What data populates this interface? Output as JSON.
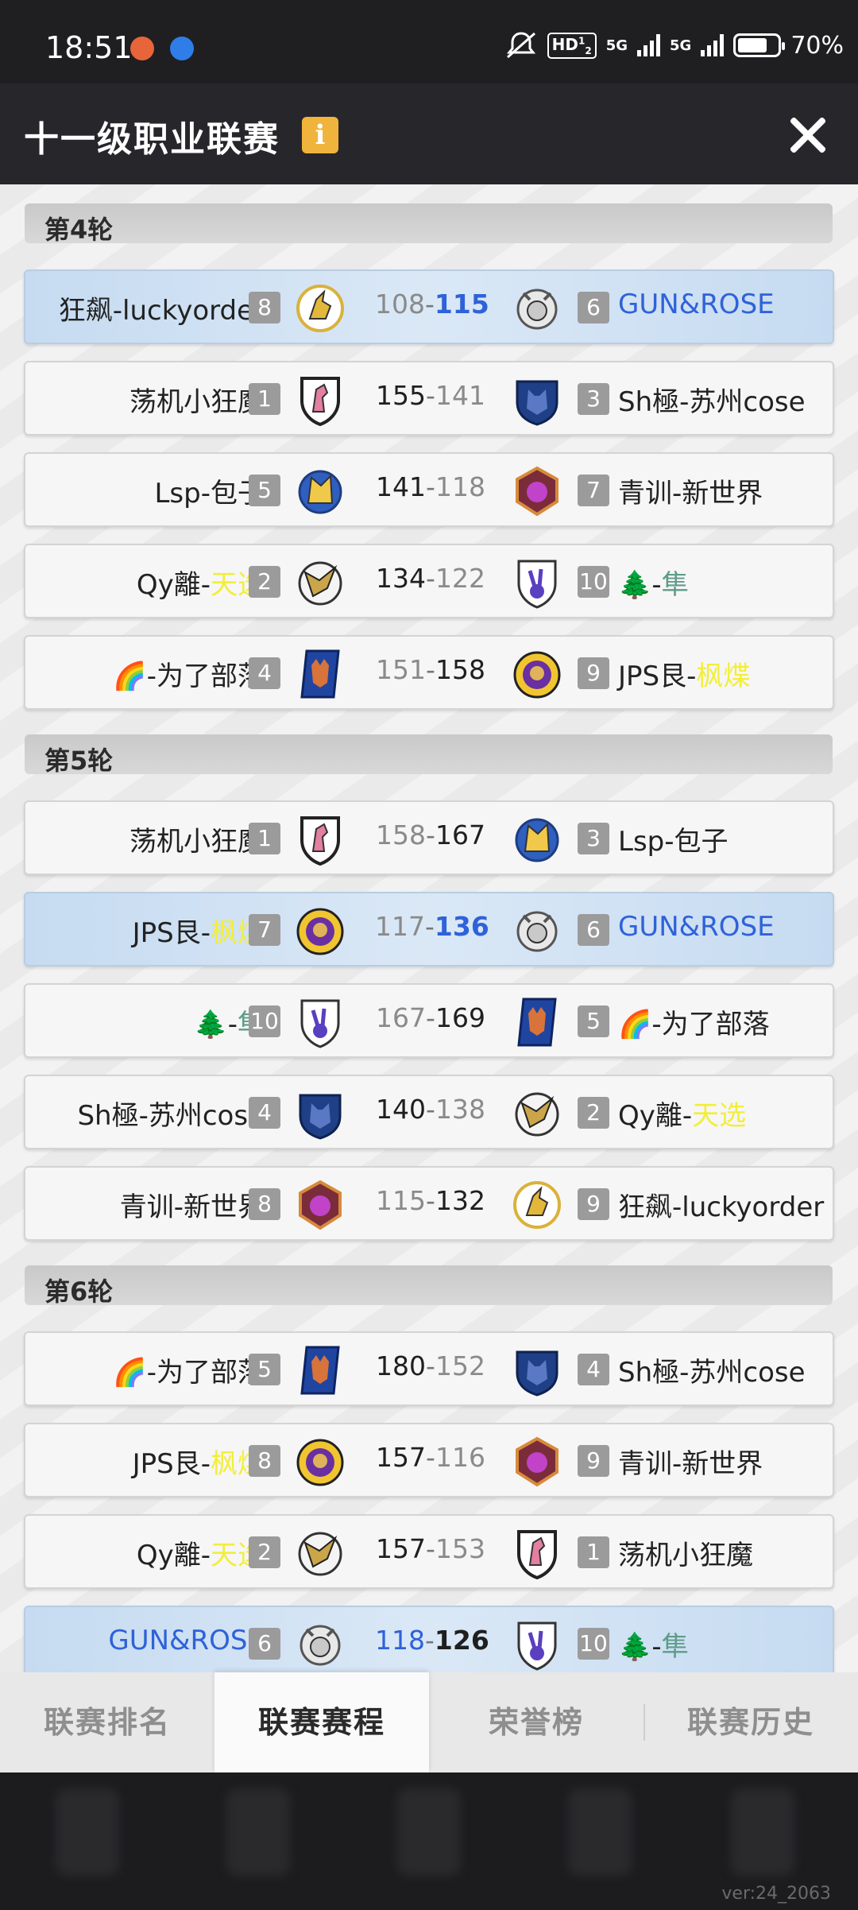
{
  "status_bar": {
    "time": "18:51",
    "network_badge": "HD",
    "network_badge_sub": "1",
    "network_badge_sub2": "2",
    "network_1": "5G",
    "network_2": "5G",
    "battery": "70%"
  },
  "header": {
    "title": "十一级职业联赛",
    "info_label": "i"
  },
  "rounds": [
    {
      "label": "第4轮",
      "matches": [
        {
          "home": "狂飙-luckyorder",
          "home_seed": "8",
          "home_score": "108",
          "away_score": "115",
          "away_seed": "6",
          "away": "GUN&ROSE"
        },
        {
          "home": "荡机小狂魔",
          "home_seed": "1",
          "home_score": "155",
          "away_score": "141",
          "away_seed": "3",
          "away": "Sh極-苏州cose"
        },
        {
          "home": "Lsp-包子",
          "home_seed": "5",
          "home_score": "141",
          "away_score": "118",
          "away_seed": "7",
          "away": "青训-新世界"
        },
        {
          "home_a": "Qy離-",
          "home_b": "天选",
          "home_seed": "2",
          "home_score": "134",
          "away_score": "122",
          "away_seed": "10",
          "away_a": "🌲-",
          "away_b": "隼"
        },
        {
          "home": "🌈-为了部落",
          "home_seed": "4",
          "home_score": "151",
          "away_score": "158",
          "away_seed": "9",
          "away_a": "JPS艮-",
          "away_b": "枫煠"
        }
      ]
    },
    {
      "label": "第5轮",
      "matches": [
        {
          "home": "荡机小狂魔",
          "home_seed": "1",
          "home_score": "158",
          "away_score": "167",
          "away_seed": "3",
          "away": "Lsp-包子"
        },
        {
          "home_a": "JPS艮-",
          "home_b": "枫煠",
          "home_seed": "7",
          "home_score": "117",
          "away_score": "136",
          "away_seed": "6",
          "away": "GUN&ROSE"
        },
        {
          "home_a": "🌲-",
          "home_b": "隼",
          "home_seed": "10",
          "home_score": "167",
          "away_score": "169",
          "away_seed": "5",
          "away": "🌈-为了部落"
        },
        {
          "home": "Sh極-苏州cose",
          "home_seed": "4",
          "home_score": "140",
          "away_score": "138",
          "away_seed": "2",
          "away_a": "Qy離-",
          "away_b": "天选"
        },
        {
          "home": "青训-新世界",
          "home_seed": "8",
          "home_score": "115",
          "away_score": "132",
          "away_seed": "9",
          "away": "狂飙-luckyorder"
        }
      ]
    },
    {
      "label": "第6轮",
      "matches": [
        {
          "home": "🌈-为了部落",
          "home_seed": "5",
          "home_score": "180",
          "away_score": "152",
          "away_seed": "4",
          "away": "Sh極-苏州cose"
        },
        {
          "home_a": "JPS艮-",
          "home_b": "枫煠",
          "home_seed": "8",
          "home_score": "157",
          "away_score": "116",
          "away_seed": "9",
          "away": "青训-新世界"
        },
        {
          "home_a": "Qy離-",
          "home_b": "天选",
          "home_seed": "2",
          "home_score": "157",
          "away_score": "153",
          "away_seed": "1",
          "away": "荡机小狂魔"
        },
        {
          "home": "GUN&ROSE",
          "home_seed": "6",
          "home_score": "118",
          "away_score": "126",
          "away_seed": "10",
          "away_a": "🌲-",
          "away_b": "隼"
        }
      ]
    }
  ],
  "tabs": [
    "联赛排名",
    "联赛赛程",
    "荣誉榜",
    "联赛历史"
  ],
  "version": "ver:24_2063",
  "colors": {
    "highlight_blue": "#2f62d9",
    "tag_yellow": "#f2ee3a",
    "tag_teal": "#5f9c8a",
    "header_bg": "#27272b",
    "info_badge": "#f0b43c"
  }
}
